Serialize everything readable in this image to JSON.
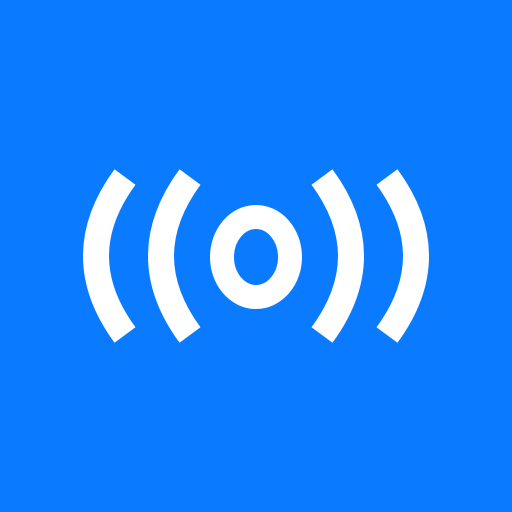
{
  "app_icon": {
    "icon": "broadcast-signal-icon",
    "colors": {
      "background": "#0A7BFF",
      "mark": "#FFFFFF"
    }
  }
}
